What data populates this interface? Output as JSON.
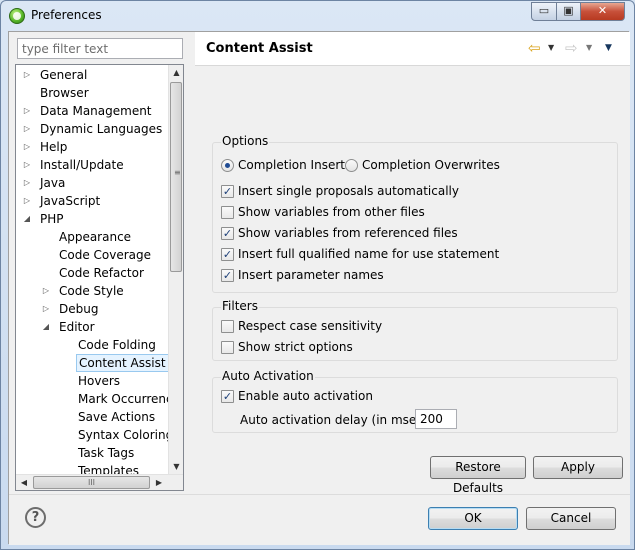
{
  "window": {
    "title": "Preferences",
    "min_glyph": "▭",
    "max_glyph": "▣",
    "close_glyph": "✕"
  },
  "filter": {
    "placeholder": "type filter text",
    "value": ""
  },
  "tree": {
    "items": [
      {
        "label": "General",
        "arrow": "▷",
        "level": 0
      },
      {
        "label": "Browser",
        "arrow": "",
        "level": 0
      },
      {
        "label": "Data Management",
        "arrow": "▷",
        "level": 0
      },
      {
        "label": "Dynamic Languages",
        "arrow": "▷",
        "level": 0
      },
      {
        "label": "Help",
        "arrow": "▷",
        "level": 0
      },
      {
        "label": "Install/Update",
        "arrow": "▷",
        "level": 0
      },
      {
        "label": "Java",
        "arrow": "▷",
        "level": 0
      },
      {
        "label": "JavaScript",
        "arrow": "▷",
        "level": 0
      },
      {
        "label": "PHP",
        "arrow": "◢",
        "level": 0
      },
      {
        "label": "Appearance",
        "arrow": "",
        "level": 1
      },
      {
        "label": "Code Coverage",
        "arrow": "",
        "level": 1
      },
      {
        "label": "Code Refactor",
        "arrow": "",
        "level": 1
      },
      {
        "label": "Code Style",
        "arrow": "▷",
        "level": 1
      },
      {
        "label": "Debug",
        "arrow": "▷",
        "level": 1
      },
      {
        "label": "Editor",
        "arrow": "◢",
        "level": 1
      },
      {
        "label": "Code Folding",
        "arrow": "",
        "level": 2
      },
      {
        "label": "Content Assist",
        "arrow": "",
        "level": 2,
        "selected": true
      },
      {
        "label": "Hovers",
        "arrow": "",
        "level": 2
      },
      {
        "label": "Mark Occurrences",
        "arrow": "",
        "level": 2
      },
      {
        "label": "Save Actions",
        "arrow": "",
        "level": 2
      },
      {
        "label": "Syntax Coloring",
        "arrow": "",
        "level": 2
      },
      {
        "label": "Task Tags",
        "arrow": "",
        "level": 2
      },
      {
        "label": "Templates",
        "arrow": "",
        "level": 2
      }
    ],
    "scroll_up": "▲",
    "scroll_down": "▼",
    "scroll_left": "◀",
    "scroll_right": "▶",
    "vgrip": "≡",
    "hgrip": "III"
  },
  "page": {
    "title": "Content Assist",
    "back_glyph": "⇦",
    "forward_glyph": "⇨",
    "dropdown_glyph": "▼"
  },
  "options": {
    "title": "Options",
    "radios": [
      {
        "label": "Completion Inserts",
        "checked": true
      },
      {
        "label": "Completion Overwrites",
        "checked": false
      }
    ],
    "checks": [
      {
        "label": "Insert single proposals automatically",
        "checked": true
      },
      {
        "label": "Show variables from other files",
        "checked": false
      },
      {
        "label": "Show variables from referenced files",
        "checked": true
      },
      {
        "label": "Insert full qualified name for use statement",
        "checked": true
      },
      {
        "label": "Insert parameter names",
        "checked": true
      }
    ]
  },
  "filters": {
    "title": "Filters",
    "checks": [
      {
        "label": "Respect case sensitivity",
        "checked": false
      },
      {
        "label": "Show strict options",
        "checked": false
      }
    ]
  },
  "auto_activation": {
    "title": "Auto Activation",
    "enable": {
      "label": "Enable auto activation",
      "checked": true
    },
    "delay_label": "Auto activation delay (in msecs)",
    "delay_value": "200"
  },
  "buttons": {
    "restore_defaults": "Restore Defaults",
    "apply": "Apply",
    "ok": "OK",
    "cancel": "Cancel",
    "help": "?"
  },
  "check_glyph": "✓"
}
